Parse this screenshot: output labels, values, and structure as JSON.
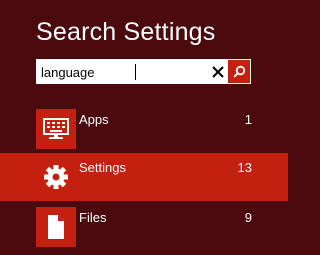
{
  "header": {
    "title": "Search Settings"
  },
  "search": {
    "value": "language",
    "clear_icon": "close-icon",
    "search_icon": "search-icon"
  },
  "results": [
    {
      "label": "Apps",
      "count": "1",
      "icon": "apps-keyboard-icon",
      "selected": false
    },
    {
      "label": "Settings",
      "count": "13",
      "icon": "gear-icon",
      "selected": true
    },
    {
      "label": "Files",
      "count": "9",
      "icon": "file-icon",
      "selected": false
    }
  ],
  "colors": {
    "background": "#4a0a0e",
    "accent": "#c4200f",
    "text": "#ffffff"
  }
}
